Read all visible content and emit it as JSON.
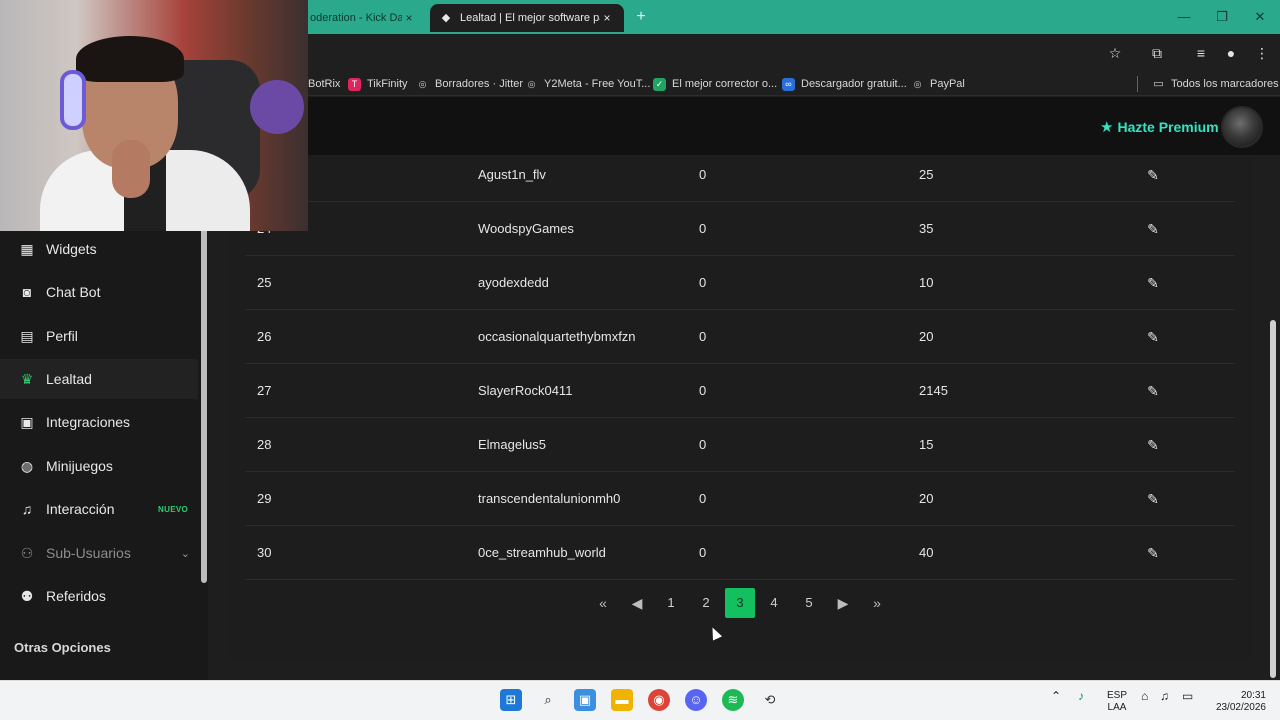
{
  "browser": {
    "tabs": [
      {
        "label": "oderation - Kick Da",
        "close": "×"
      },
      {
        "label": "Lealtad | El mejor software para",
        "close": "×"
      }
    ],
    "new_tab": "+",
    "bookmarks": [
      {
        "label": "BotRix"
      },
      {
        "label": "TikFinity"
      },
      {
        "label": "Borradores · Jitter"
      },
      {
        "label": "Y2Meta - Free YouT..."
      },
      {
        "label": "El mejor corrector o..."
      },
      {
        "label": "Descargador gratuit..."
      },
      {
        "label": "PayPal"
      }
    ],
    "all_bookmarks": "Todos los marcadores"
  },
  "header": {
    "premium_label": "Hazte Premium"
  },
  "sidebar": {
    "items": [
      {
        "label": "Widgets"
      },
      {
        "label": "Chat Bot"
      },
      {
        "label": "Perfil"
      },
      {
        "label": "Lealtad"
      },
      {
        "label": "Integraciones"
      },
      {
        "label": "Minijuegos"
      },
      {
        "label": "Interacción",
        "badge": "NUEVO"
      },
      {
        "label": "Sub-Usuarios"
      },
      {
        "label": "Referidos"
      }
    ],
    "section_title": "Otras Opciones"
  },
  "table": {
    "rows": [
      {
        "rank": "",
        "user": "Agust1n_flv",
        "a": "0",
        "b": "25"
      },
      {
        "rank": "24",
        "user": "WoodspyGames",
        "a": "0",
        "b": "35"
      },
      {
        "rank": "25",
        "user": "ayodexdedd",
        "a": "0",
        "b": "10"
      },
      {
        "rank": "26",
        "user": "occasionalquartethybmxfzn",
        "a": "0",
        "b": "20"
      },
      {
        "rank": "27",
        "user": "SlayerRock0411",
        "a": "0",
        "b": "2145"
      },
      {
        "rank": "28",
        "user": "Elmagelus5",
        "a": "0",
        "b": "15"
      },
      {
        "rank": "29",
        "user": "transcendentalunionmh0",
        "a": "0",
        "b": "20"
      },
      {
        "rank": "30",
        "user": "0ce_streamhub_world",
        "a": "0",
        "b": "40"
      }
    ]
  },
  "pagination": {
    "pages": [
      "1",
      "2",
      "3",
      "4",
      "5"
    ],
    "current": "3"
  },
  "taskbar": {
    "lang_top": "ESP",
    "lang_bottom": "LAA",
    "time": "20:31",
    "date": "23/02/2026"
  }
}
